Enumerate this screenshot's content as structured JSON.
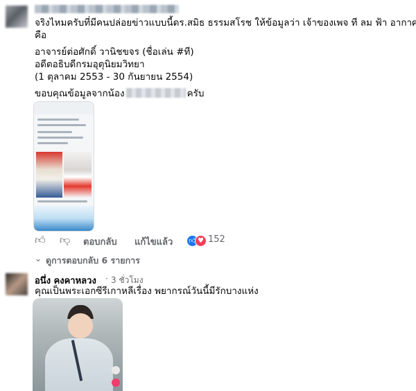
{
  "comment1": {
    "line1": "จริงไหมครับที่มีคนปล่อยข่าวแบบนี้ดร.สมิธ ธรรมสโรช ให้ข้อมูลว่า เจ้าของเพจ ที ลม ฟ้า อากาศ",
    "line2": "คือ",
    "line3": "อาจารย์ต่อศักดิ์ วานิชขจร (ชื่อเล่น #ที)",
    "line4": "อดีตอธิบดีกรมอุตุนิยมวิทยา",
    "line5": "(1 ตุลาคม 2553 - 30 กันยายน 2554)",
    "thanks_prefix": "ขอบคุณข้อมูลจากน้อง",
    "thanks_suffix": "ครับ"
  },
  "actions": {
    "reply": "ตอบกลับ",
    "edited": "แก้ไขแล้ว",
    "reaction_count": "152"
  },
  "replies_toggle": "ดูการตอบกลับ 6 รายการ",
  "comment2": {
    "author": "อนึ่ง คงคาหลวง",
    "time": "3 ชั่วโมง",
    "text": "คุณเป็นพระเอกซีรีเกาหลีเรื่อง พยากรณ์วันนี้มีรักบางแห่ง"
  },
  "colors": {
    "text": "#050505",
    "muted": "#65676b",
    "like": "#1877f2",
    "love": "#f33e58"
  }
}
